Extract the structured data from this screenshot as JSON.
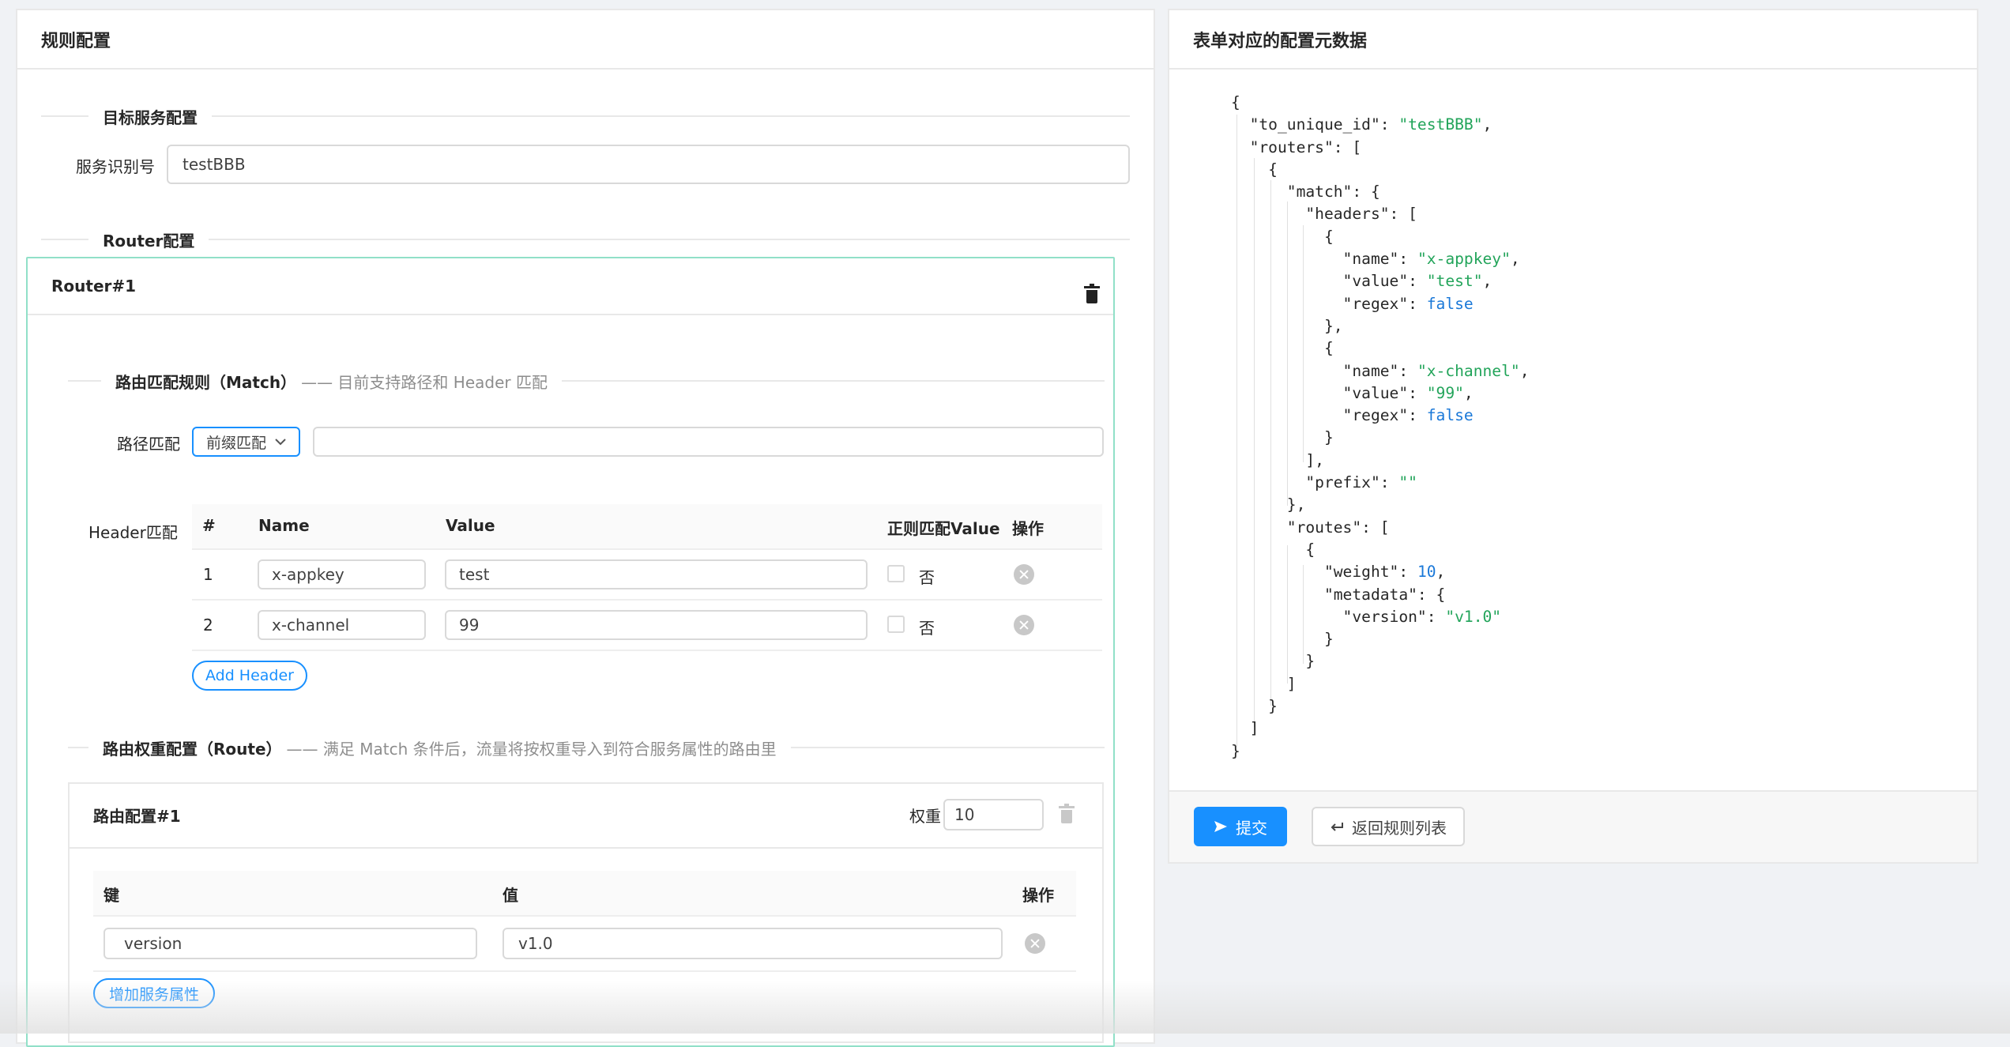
{
  "left": {
    "title": "规则配置",
    "target_section": "目标服务配置",
    "service_id_label": "服务识别号",
    "service_id_value": "testBBB",
    "router_section": "Router配置",
    "router": {
      "title": "Router#1",
      "match_section": "路由匹配规则（Match）",
      "match_desc": "—— 目前支持路径和 Header 匹配",
      "path_label": "路径匹配",
      "path_mode": "前缀匹配",
      "path_value": "",
      "header_label": "Header匹配",
      "header_columns": [
        "#",
        "Name",
        "Value",
        "正则匹配Value",
        "操作"
      ],
      "headers": [
        {
          "index": "1",
          "name": "x-appkey",
          "value": "test",
          "regex_label": "否"
        },
        {
          "index": "2",
          "name": "x-channel",
          "value": "99",
          "regex_label": "否"
        }
      ],
      "add_header_label": "Add Header",
      "route_section": "路由权重配置（Route）",
      "route_desc": "—— 满足 Match 条件后，流量将按权重导入到符合服务属性的路由里",
      "route": {
        "title": "路由配置#1",
        "weight_label": "权重",
        "weight_value": "10",
        "meta_columns": [
          "键",
          "值",
          "操作"
        ],
        "meta": [
          {
            "key": "version",
            "value": "v1.0"
          }
        ],
        "add_meta_label": "增加服务属性"
      }
    }
  },
  "right": {
    "title": "表单对应的配置元数据",
    "submit_label": "提交",
    "back_label": "返回规则列表"
  },
  "colors": {
    "primary": "#1890ff",
    "json_string": "#22a45a",
    "json_number": "#1a78d8",
    "router_border": "#91e0c8"
  },
  "icons": {
    "delete": "trash-icon",
    "remove_row": "close-circle-icon",
    "dropdown": "chevron-down-icon",
    "submit": "send-icon",
    "back": "return-icon"
  }
}
